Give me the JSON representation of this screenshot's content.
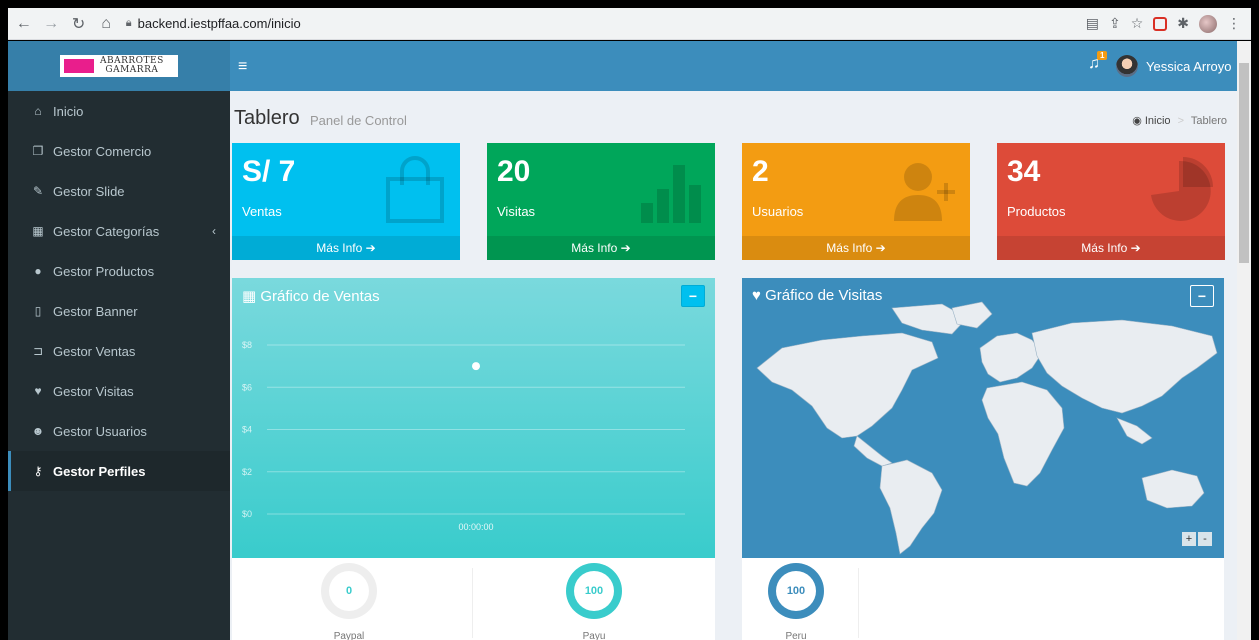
{
  "browser": {
    "url": "backend.iestpffaa.com/inicio"
  },
  "header": {
    "logo_text_line1": "ABARROTES",
    "logo_text_line2": "GAMARRA",
    "notification_count": "1",
    "user_name": "Yessica Arroyo"
  },
  "sidebar": {
    "items": [
      {
        "label": "Inicio",
        "icon": "home-icon"
      },
      {
        "label": "Gestor Comercio",
        "icon": "files-icon"
      },
      {
        "label": "Gestor Slide",
        "icon": "edit-icon"
      },
      {
        "label": "Gestor Categorías",
        "icon": "grid-icon"
      },
      {
        "label": "Gestor Productos",
        "icon": "product-hunt-icon"
      },
      {
        "label": "Gestor Banner",
        "icon": "map-icon"
      },
      {
        "label": "Gestor Ventas",
        "icon": "cart-icon"
      },
      {
        "label": "Gestor Visitas",
        "icon": "map-marker-icon"
      },
      {
        "label": "Gestor Usuarios",
        "icon": "users-icon"
      },
      {
        "label": "Gestor Perfiles",
        "icon": "key-icon"
      }
    ]
  },
  "page": {
    "title": "Tablero",
    "subtitle": "Panel de Control",
    "breadcrumb_home": "Inicio",
    "breadcrumb_current": "Tablero"
  },
  "stats": [
    {
      "value": "S/ 7",
      "label": "Ventas",
      "more": "Más Info",
      "color": "#00c0ef"
    },
    {
      "value": "20",
      "label": "Visitas",
      "more": "Más Info",
      "color": "#00a65a"
    },
    {
      "value": "2",
      "label": "Usuarios",
      "more": "Más Info",
      "color": "#f39c12"
    },
    {
      "value": "34",
      "label": "Productos",
      "more": "Más Info",
      "color": "#dd4b39"
    }
  ],
  "sales_panel": {
    "title": "Gráfico de Ventas"
  },
  "visits_panel": {
    "title": "Gráfico de Visitas"
  },
  "chart_data": {
    "type": "line",
    "x": [
      "00:00:00"
    ],
    "series": [
      {
        "values": [
          7
        ]
      }
    ],
    "yticks": [
      "$0",
      "$2",
      "$4",
      "$6",
      "$8"
    ],
    "ylim": [
      0,
      8
    ],
    "grid": true
  },
  "payment_donuts": [
    {
      "label": "Paypal",
      "value": "0",
      "color": "#d2d6de"
    },
    {
      "label": "Payu",
      "value": "100",
      "color": "#39cccc"
    }
  ],
  "visit_donuts": [
    {
      "label": "Peru",
      "value": "100",
      "color": "#3c8dbc"
    }
  ],
  "map_zoom": {
    "plus": "+",
    "minus": "-"
  }
}
